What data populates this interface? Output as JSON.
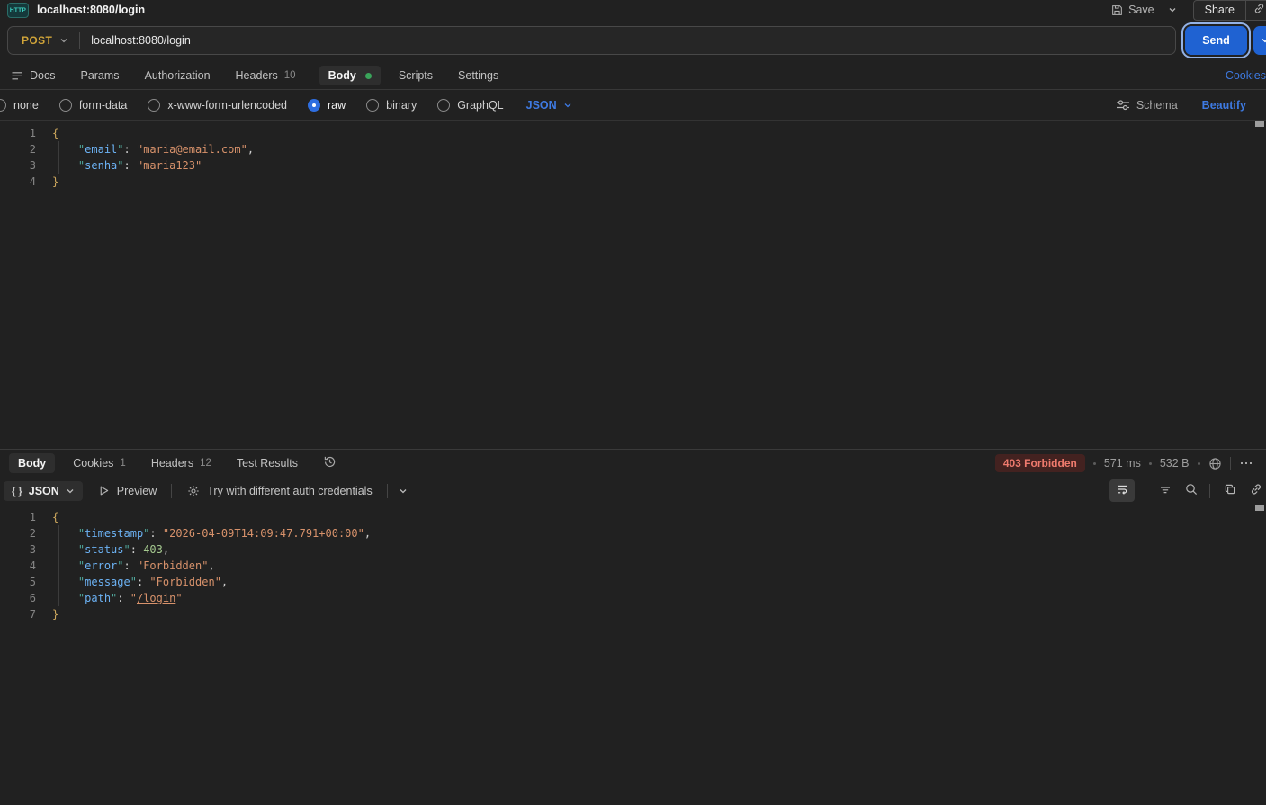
{
  "titlebar": {
    "title": "localhost:8080/login",
    "save_label": "Save",
    "share_label": "Share"
  },
  "request": {
    "method": "POST",
    "url": "localhost:8080/login",
    "send_label": "Send",
    "tabs": [
      {
        "label": "Docs",
        "icon": "docs"
      },
      {
        "label": "Params"
      },
      {
        "label": "Authorization"
      },
      {
        "label": "Headers",
        "count": "10"
      },
      {
        "label": "Body",
        "active": true,
        "dot": true
      },
      {
        "label": "Scripts"
      },
      {
        "label": "Settings"
      }
    ],
    "cookies_label": "Cookies",
    "body_modes": [
      "none",
      "form-data",
      "x-www-form-urlencoded",
      "raw",
      "binary",
      "GraphQL"
    ],
    "selected_mode": "raw",
    "language": "JSON",
    "schema_label": "Schema",
    "beautify_label": "Beautify",
    "body_lines": [
      "{",
      "    \"email\": \"maria@email.com\",",
      "    \"senha\": \"maria123\"",
      "}"
    ]
  },
  "response": {
    "tabs": [
      {
        "label": "Body",
        "active": true
      },
      {
        "label": "Cookies",
        "count": "1"
      },
      {
        "label": "Headers",
        "count": "12"
      },
      {
        "label": "Test Results"
      }
    ],
    "status": "403 Forbidden",
    "time": "571 ms",
    "size": "532 B",
    "format": "JSON",
    "preview_label": "Preview",
    "auth_action_label": "Try with different auth credentials",
    "body_lines": [
      "{",
      "    \"timestamp\": \"2026-04-09T14:09:47.791+00:00\",",
      "    \"status\": 403,",
      "    \"error\": \"Forbidden\",",
      "    \"message\": \"Forbidden\",",
      "    \"path\": \"/login\"",
      "}"
    ]
  },
  "colors": {
    "accent_blue": "#3e7ae2",
    "method_post_gold": "#d0a439",
    "send_button_blue": "#1f62d2",
    "status_error_text": "#ee7a6d",
    "status_error_bg": "#432220",
    "body_dot_green": "#3aa45a",
    "http_icon_teal": "#3ed6c5"
  }
}
